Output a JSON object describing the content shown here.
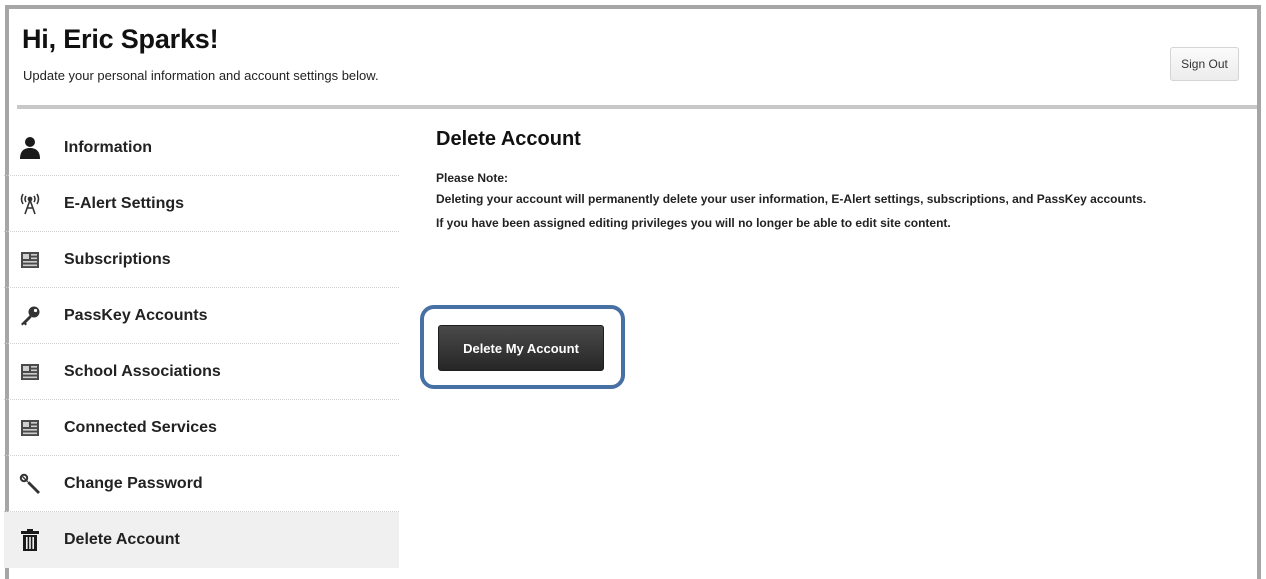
{
  "header": {
    "greeting": "Hi, Eric Sparks!",
    "subtitle": "Update your personal information and account settings below.",
    "sign_out_label": "Sign Out"
  },
  "sidebar": {
    "items": [
      {
        "label": "Information",
        "icon": "person-icon"
      },
      {
        "label": "E-Alert Settings",
        "icon": "antenna-icon"
      },
      {
        "label": "Subscriptions",
        "icon": "newspaper-icon"
      },
      {
        "label": "PassKey Accounts",
        "icon": "key-icon"
      },
      {
        "label": "School Associations",
        "icon": "newspaper-icon"
      },
      {
        "label": "Connected Services",
        "icon": "newspaper-icon"
      },
      {
        "label": "Change Password",
        "icon": "wrench-icon"
      },
      {
        "label": "Delete Account",
        "icon": "trash-icon",
        "active": true
      }
    ]
  },
  "main": {
    "title": "Delete Account",
    "note_heading": "Please Note:",
    "note_paragraphs": [
      "Deleting your account will permanently delete your user information, E-Alert settings, subscriptions, and PassKey accounts.",
      "If you have been assigned editing privileges you will no longer be able to edit site content."
    ],
    "delete_button_label": "Delete My Account"
  },
  "colors": {
    "highlight_border": "#4770a4",
    "header_rule": "#c8c8c8",
    "frame_border": "#a6a6a6",
    "active_item_bg": "#f0f0f0",
    "button_bg": "#333333"
  }
}
